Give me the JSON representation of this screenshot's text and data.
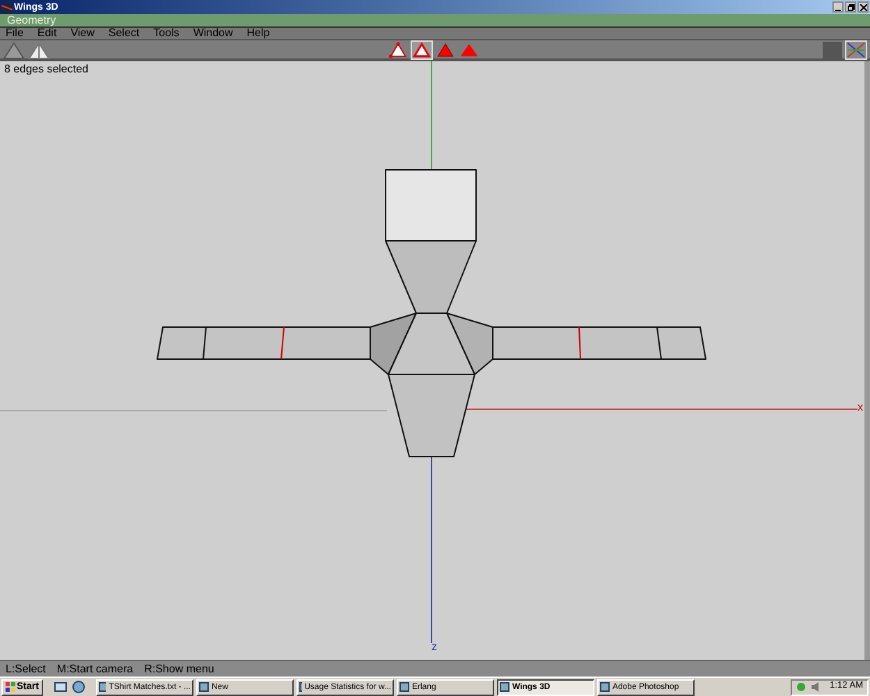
{
  "window": {
    "title": "Wings 3D"
  },
  "panel": {
    "title": "Geometry"
  },
  "menu": [
    "File",
    "Edit",
    "View",
    "Select",
    "Tools",
    "Window",
    "Help"
  ],
  "select_modes": [
    {
      "kind": "vertex",
      "selected": false
    },
    {
      "kind": "edge",
      "selected": true
    },
    {
      "kind": "face",
      "selected": false
    },
    {
      "kind": "body",
      "selected": false
    }
  ],
  "view_buttons": [
    {
      "kind": "shaded",
      "selected": false
    },
    {
      "kind": "axes",
      "selected": true
    }
  ],
  "viewport": {
    "info": "8 edges selected",
    "axis_labels": [
      "x",
      "z"
    ]
  },
  "help_bar": [
    "L:Select",
    "M:Start camera",
    "R:Show menu"
  ],
  "taskbar": {
    "start": "Start",
    "tasks": [
      {
        "label": "TShirt Matches.txt - ...",
        "selected": false
      },
      {
        "label": "New",
        "selected": false
      },
      {
        "label": "Usage Statistics for w...",
        "selected": false
      },
      {
        "label": "Erlang",
        "selected": false
      },
      {
        "label": "Wings 3D",
        "selected": true
      },
      {
        "label": "Adobe Photoshop",
        "selected": false
      }
    ],
    "clock": "1:12 AM"
  }
}
